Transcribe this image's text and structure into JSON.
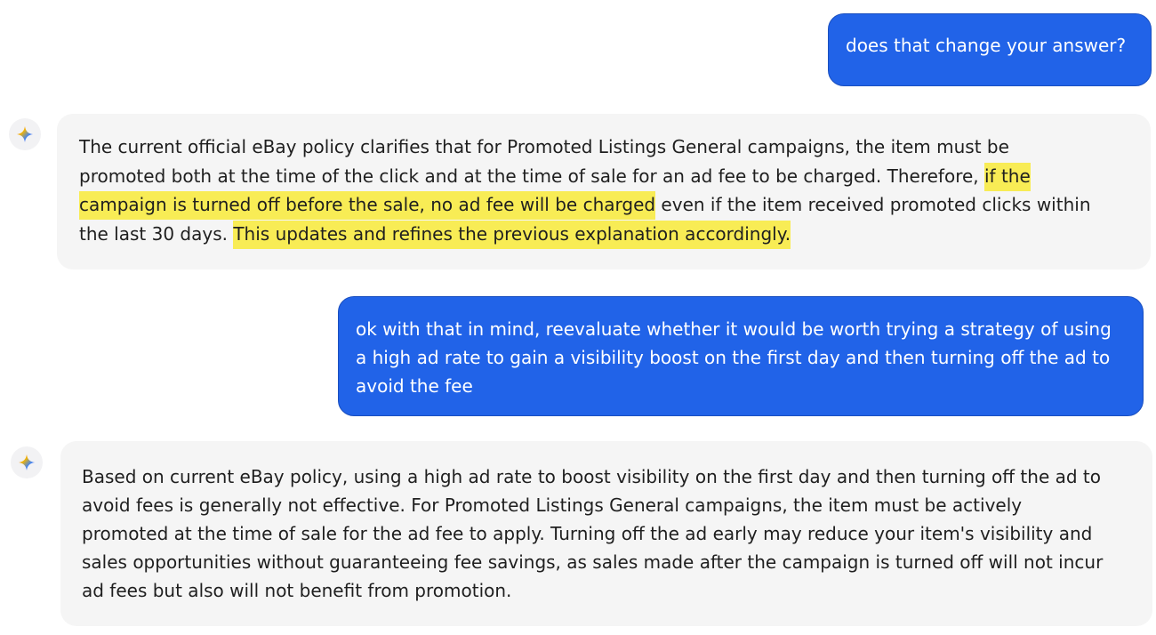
{
  "messages": [
    {
      "role": "user",
      "text": "does that change your answer?"
    },
    {
      "role": "assistant",
      "lines": [
        [
          "The current official eBay policy clarifies that for Promoted Listings General campaigns, the item must be"
        ],
        [
          "promoted both at the time of the click and at the time of sale for an ad fee to be charged. Therefore, ",
          "if the"
        ],
        [
          "campaign is turned off before the sale, no ad fee will be charged",
          " even if the item received promoted clicks within"
        ],
        [
          "the last 30 days. ",
          "This updates and refines the previous explanation accordingly."
        ]
      ]
    },
    {
      "role": "user",
      "lines": [
        "ok with that in mind, reevaluate whether it would be worth trying a strategy of using",
        "a high ad rate to gain a visibility boost on the first day and then turning off the ad to",
        "avoid the fee"
      ]
    },
    {
      "role": "assistant",
      "lines": [
        "Based on current eBay policy, using a high ad rate to boost visibility on the first day and then turning off the ad to",
        "avoid fees is generally not effective. For Promoted Listings General campaigns, the item must be actively",
        "promoted at the time of sale for the ad fee to apply. Turning off the ad early may reduce your item's visibility and",
        "sales opportunities without guaranteeing fee savings, as sales made after the campaign is turned off will not incur",
        "ad fees but also will not benefit from promotion."
      ]
    }
  ],
  "colors": {
    "user_bubble": "#2163e8",
    "assistant_bubble": "#f5f5f5",
    "highlight": "#f8ec55"
  },
  "icons": {
    "assistant_avatar": "sparkle-icon"
  }
}
